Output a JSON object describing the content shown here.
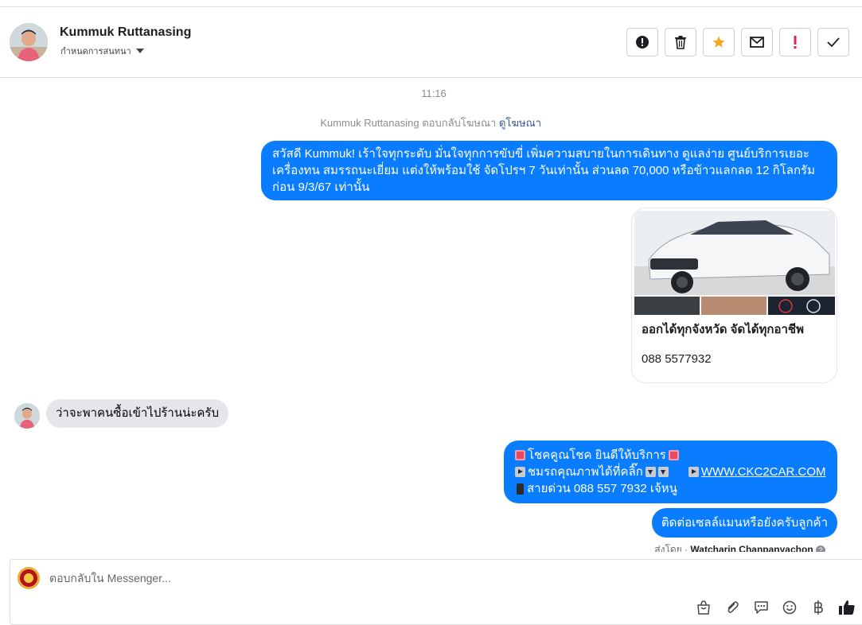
{
  "contact": {
    "name": "Kummuk Ruttanasing",
    "subtitle": "กำหนดการสนทนา"
  },
  "header_actions": [
    {
      "icon": "exclamation-circle-icon"
    },
    {
      "icon": "trash-icon"
    },
    {
      "icon": "star-icon",
      "color": "#f5a623"
    },
    {
      "icon": "envelope-icon"
    },
    {
      "icon": "exclamation-icon",
      "color": "#e0245e"
    },
    {
      "icon": "check-icon"
    }
  ],
  "conversation": {
    "timestamp": "11:16",
    "ad_reply": {
      "text": "Kummuk Ruttanasing ตอบกลับโฆษณา",
      "link": "ดูโฆษณา"
    },
    "messages": {
      "greeting": "สวัสดี Kummuk! เร้าใจทุกระดับ มั่นใจทุกการขับขี่ เพิ่มความสบายในการเดินทาง ดูแลง่าย ศูนย์บริการเยอะ เครื่องทน สมรรถนะเยี่ยม แต่งให้พร้อมใช้ จัดโปรฯ 7 วันเท่านั้น ส่วนลด 70,000 หรือข้าวแลกลด 12 กิโลกรัม ก่อน 9/3/67 เท่านั้น",
      "card_title": "ออกได้ทุกจังหวัด จัดได้ทุกอาชีพ",
      "card_phone": "088 5577932",
      "incoming": "ว่าจะพาคนซื้อเข้าไปร้านน่ะครับ",
      "promo_line1": "โชคคูณโชค ยินดีให้บริการ",
      "promo_line2a": "ชมรถคุณภาพได้ที่คลิ๊ก",
      "promo_link": "WWW.CKC2CAR.COM",
      "promo_line3": "สายด่วน 088 557 7932 เจ้หนู",
      "followup": "ติดต่อเซลล์แมนหรือยังครับลูกค้า"
    },
    "sent_by": {
      "prefix": "ส่งโดย",
      "name": "Watcharin Chanpanyachon"
    }
  },
  "composer": {
    "placeholder": "ตอบกลับใน Messenger...",
    "tools": [
      "bag-icon",
      "paperclip-icon",
      "chat-bubble-icon",
      "smiley-icon",
      "baht-icon",
      "thumbs-up-icon"
    ]
  },
  "colors": {
    "accent": "#0a7cff",
    "incoming_bubble": "#e4e6eb"
  }
}
